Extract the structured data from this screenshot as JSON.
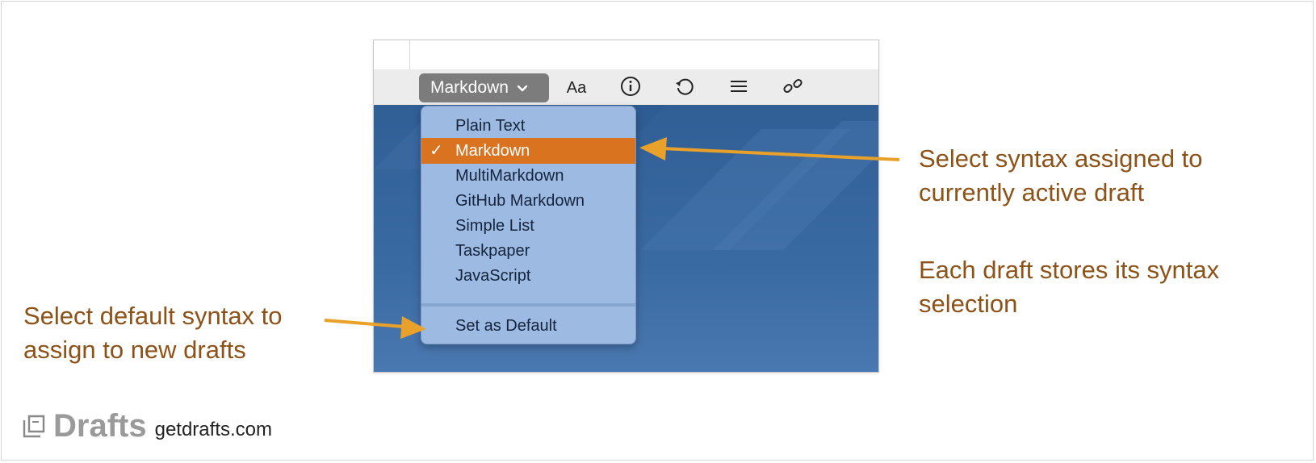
{
  "toolbar": {
    "syntax_button_label": "Markdown",
    "font_button_label": "Aa"
  },
  "syntax_menu": {
    "items": [
      {
        "label": "Plain Text",
        "selected": false
      },
      {
        "label": "Markdown",
        "selected": true
      },
      {
        "label": "MultiMarkdown",
        "selected": false
      },
      {
        "label": "GitHub Markdown",
        "selected": false
      },
      {
        "label": "Simple List",
        "selected": false
      },
      {
        "label": "Taskpaper",
        "selected": false
      },
      {
        "label": "JavaScript",
        "selected": false
      }
    ],
    "set_default_label": "Set as Default",
    "check_mark": "✓"
  },
  "callouts": {
    "active_draft_line1": "Select syntax assigned to",
    "active_draft_line2": "currently active draft",
    "stores_line1": "Each draft stores its syntax",
    "stores_line2": "selection",
    "default_line1": "Select default syntax to",
    "default_line2": "assign to new drafts"
  },
  "brand": {
    "name": "Drafts",
    "url": "getdrafts.com"
  },
  "colors": {
    "accent": "#d9731f",
    "arrow": "#e9a12a",
    "callout_text": "#8c5218",
    "menu_bg": "#9dbbe2"
  },
  "icons": [
    "chevron-down-icon",
    "info-icon",
    "undo-icon",
    "menu-lines-icon",
    "link-icon",
    "drafts-logo-icon"
  ]
}
